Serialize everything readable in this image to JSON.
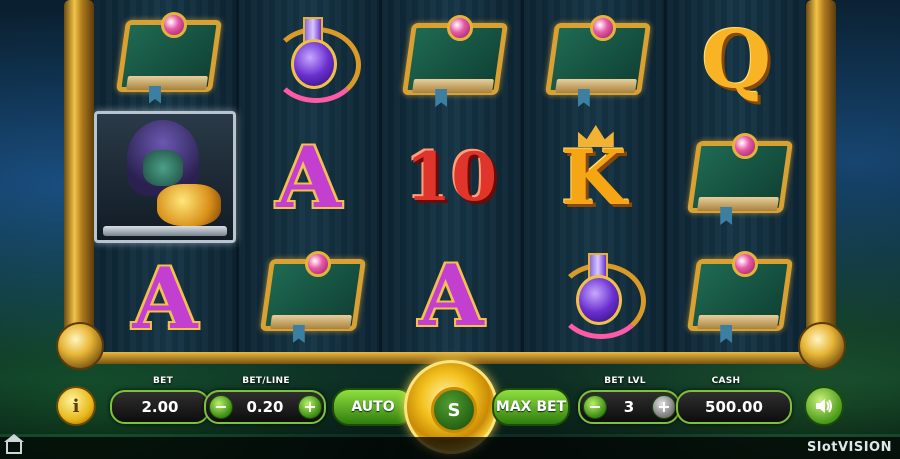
{
  "reels": [
    [
      "book",
      "wild",
      "a"
    ],
    [
      "potion",
      "a",
      "book"
    ],
    [
      "book",
      "10",
      "a"
    ],
    [
      "book",
      "k",
      "potion"
    ],
    [
      "q",
      "book",
      "book"
    ]
  ],
  "symbol_text": {
    "a": "A",
    "k": "K",
    "q": "Q",
    "ten": "10"
  },
  "controls": {
    "bet_label": "BET",
    "bet_value": "2.00",
    "betline_label": "BET/LINE",
    "betline_value": "0.20",
    "minus": "−",
    "plus": "+",
    "auto_label": "AUTO",
    "spin_label": "S",
    "maxbet_label": "MAX BET",
    "betlvl_label": "BET LVL",
    "betlvl_value": "3",
    "cash_label": "CASH",
    "cash_value": "500.00"
  },
  "icons": {
    "info": "info-icon",
    "sound": "sound-icon",
    "home": "home-icon"
  },
  "branding": {
    "logo": "SlotVISION"
  },
  "colors": {
    "accent_green": "#7ec23a",
    "gold": "#f3c21e"
  }
}
